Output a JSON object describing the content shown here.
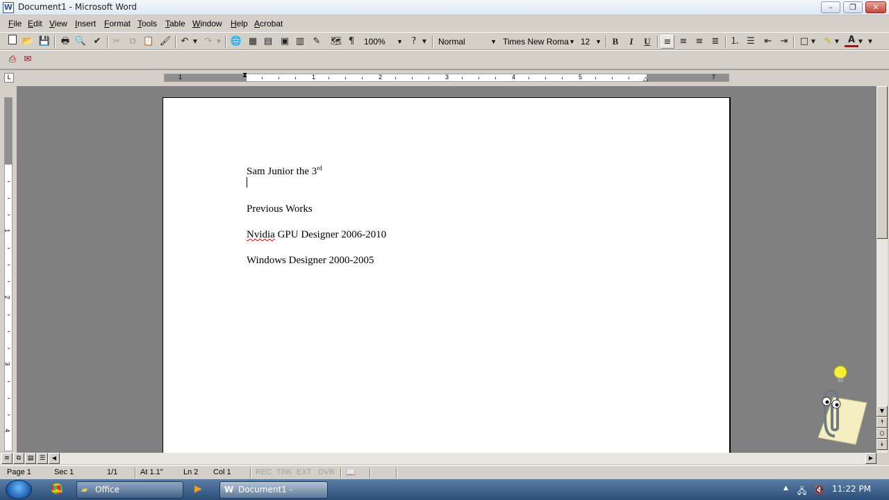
{
  "window": {
    "title": "Document1 - Microsoft Word"
  },
  "menu": [
    {
      "label": "File",
      "u": "F",
      "rest": "ile"
    },
    {
      "label": "Edit",
      "u": "E",
      "rest": "dit"
    },
    {
      "label": "View",
      "u": "V",
      "rest": "iew"
    },
    {
      "label": "Insert",
      "u": "I",
      "rest": "nsert"
    },
    {
      "label": "Format",
      "u": "F",
      "rest": "ormat"
    },
    {
      "label": "Tools",
      "u": "T",
      "rest": "ools"
    },
    {
      "label": "Table",
      "u": "T",
      "rest": "able"
    },
    {
      "label": "Window",
      "u": "W",
      "rest": "indow"
    },
    {
      "label": "Help",
      "u": "H",
      "rest": "elp"
    },
    {
      "label": "Acrobat",
      "u": "A",
      "rest": "crobat"
    }
  ],
  "toolbar": {
    "zoom": "100%",
    "style": "Normal",
    "font": "Times New Roma",
    "size": "12"
  },
  "ruler": {
    "numbers": [
      "1",
      "1",
      "2",
      "3",
      "4",
      "5",
      "7"
    ],
    "vnumbers": [
      "1",
      "2",
      "3",
      "4"
    ]
  },
  "document": {
    "name_line": "Sam Junior the 3",
    "name_sup": "rd",
    "heading": "Previous Works",
    "job1_word": "Nvidia",
    "job1_rest": " GPU Designer 2006-2010",
    "job2": "Windows Designer 2000-2005"
  },
  "status": {
    "page": "Page  1",
    "sec": "Sec  1",
    "pages": "1/1",
    "at": "At  1.1\"",
    "ln": "Ln  2",
    "col": "Col  1",
    "rec": "REC",
    "trk": "TRK",
    "ext": "EXT",
    "ovr": "OVR"
  },
  "taskbar": {
    "items": [
      "Office",
      "Document1 - Micros..."
    ],
    "clock": "11:22 PM"
  },
  "icons": [
    "word-app-icon",
    "new-icon",
    "open-icon",
    "save-icon",
    "print-icon",
    "print-preview-icon",
    "spelling-icon",
    "cut-icon",
    "copy-icon",
    "paste-icon",
    "format-painter-icon",
    "undo-icon",
    "redo-icon",
    "hyperlink-icon",
    "tables-borders-icon",
    "insert-table-icon",
    "insert-excel-icon",
    "columns-icon",
    "drawing-icon",
    "document-map-icon",
    "show-hide-icon",
    "help-icon",
    "bold-icon",
    "italic-icon",
    "underline-icon",
    "align-left-icon",
    "center-icon",
    "align-right-icon",
    "justify-icon",
    "numbering-icon",
    "bullets-icon",
    "decrease-indent-icon",
    "increase-indent-icon",
    "borders-icon",
    "highlight-icon",
    "font-color-icon",
    "pdf-convert-icon",
    "pdf-email-icon",
    "clippy-assistant-icon",
    "lightbulb-icon"
  ]
}
